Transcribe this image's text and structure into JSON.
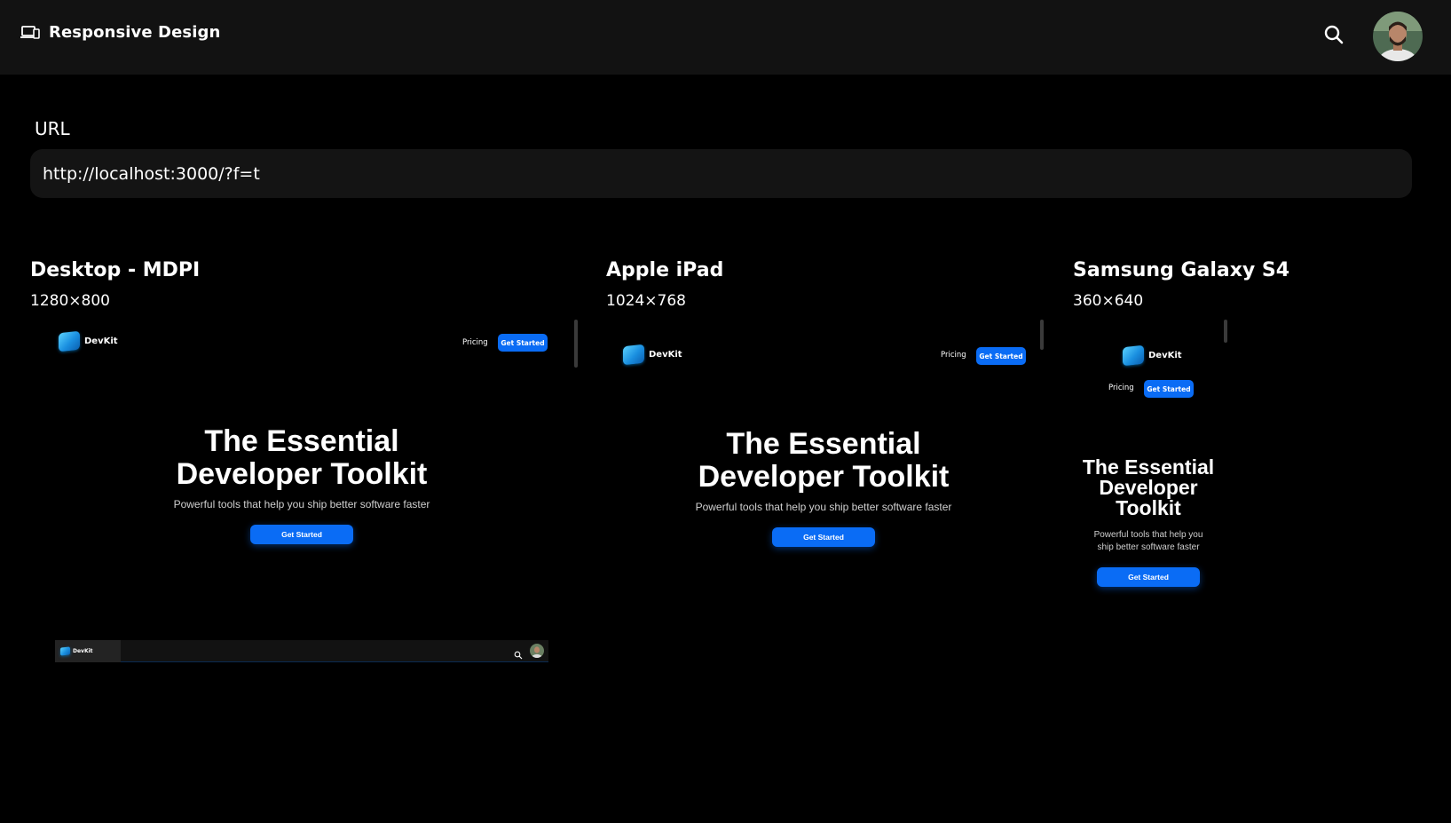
{
  "app": {
    "title": "Responsive Design",
    "icon": "devices-icon"
  },
  "header": {
    "search_icon": "search-icon",
    "avatar": "user-avatar"
  },
  "url": {
    "label": "URL",
    "value": "http://localhost:3000/?f=t"
  },
  "devices": [
    {
      "name": "Desktop - MDPI",
      "size": "1280×800"
    },
    {
      "name": "Apple iPad",
      "size": "1024×768"
    },
    {
      "name": "Samsung Galaxy S4",
      "size": "360×640"
    }
  ],
  "preview": {
    "brand": "DevKit",
    "nav_pricing": "Pricing",
    "nav_cta": "Get Started",
    "hero_title_wide": "The Essential Developer Toolkit",
    "hero_title_line1": "The Essential",
    "hero_title_line2": "Developer Toolkit",
    "mobile_title_line1": "The Essential",
    "mobile_title_line2": "Developer",
    "mobile_title_line3": "Toolkit",
    "hero_subtitle": "Powerful tools that help you ship better software faster",
    "mobile_sub_line1": "Powerful tools that help you",
    "mobile_sub_line2": "ship better software faster",
    "hero_cta": "Get Started",
    "bar_brand": "DevKit"
  },
  "colors": {
    "background": "#000000",
    "topbar": "#121212",
    "accent": "#0a6cf5"
  }
}
